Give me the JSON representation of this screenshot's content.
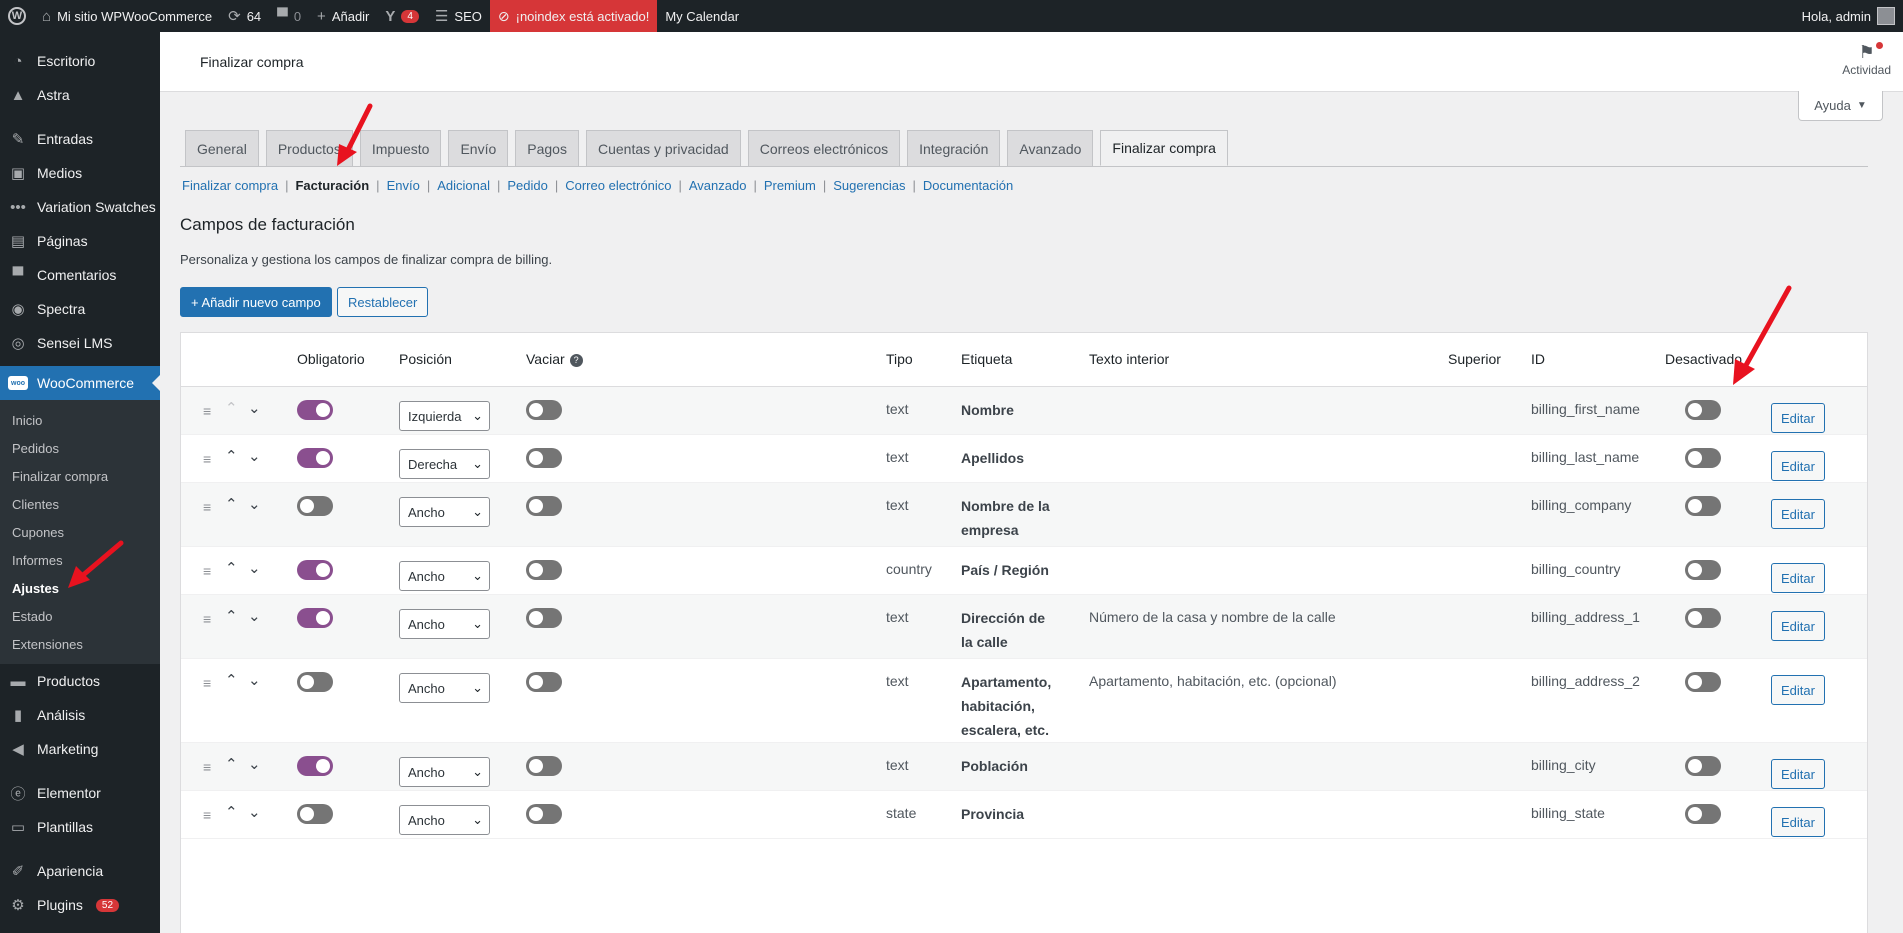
{
  "admin_bar": {
    "site_name": "Mi sitio WPWooCommerce",
    "updates_count": "64",
    "comments_count": "0",
    "add_label": "Añadir",
    "yoast_count": "4",
    "seo_label": "SEO",
    "noindex_label": "¡noindex está activado!",
    "calendar_label": "My Calendar",
    "greeting": "Hola, admin"
  },
  "sidebar": {
    "items_top": [
      {
        "label": "Escritorio",
        "icon": "dashboard-icon"
      },
      {
        "label": "Astra",
        "icon": "astra-icon"
      }
    ],
    "items_mid": [
      {
        "label": "Entradas",
        "icon": "pin-icon"
      },
      {
        "label": "Medios",
        "icon": "media-icon"
      },
      {
        "label": "Variation Swatches",
        "icon": "dots-icon"
      },
      {
        "label": "Páginas",
        "icon": "page-icon"
      },
      {
        "label": "Comentarios",
        "icon": "comment-icon"
      },
      {
        "label": "Spectra",
        "icon": "spectra-icon"
      },
      {
        "label": "Sensei LMS",
        "icon": "sensei-icon"
      }
    ],
    "woocommerce": {
      "label": "WooCommerce",
      "logo_text": "woo"
    },
    "woo_submenu": [
      "Inicio",
      "Pedidos",
      "Finalizar compra",
      "Clientes",
      "Cupones",
      "Informes",
      "Ajustes",
      "Estado",
      "Extensiones"
    ],
    "woo_current_sub": "Ajustes",
    "items_after": [
      {
        "label": "Productos",
        "icon": "products-icon"
      },
      {
        "label": "Análisis",
        "icon": "chart-icon"
      },
      {
        "label": "Marketing",
        "icon": "megaphone-icon"
      }
    ],
    "items_bottom": [
      {
        "label": "Elementor",
        "icon": "elementor-icon"
      },
      {
        "label": "Plantillas",
        "icon": "folder-icon"
      }
    ],
    "items_end": [
      {
        "label": "Apariencia",
        "icon": "brush-icon"
      },
      {
        "label": "Plugins",
        "icon": "plugin-icon",
        "badge": "52"
      }
    ]
  },
  "header": {
    "page_title": "Finalizar compra",
    "activity_label": "Actividad"
  },
  "help_label": "Ayuda",
  "tabs": [
    "General",
    "Productos",
    "Impuesto",
    "Envío",
    "Pagos",
    "Cuentas y privacidad",
    "Correos electrónicos",
    "Integración",
    "Avanzado",
    "Finalizar compra"
  ],
  "active_tab": "Finalizar compra",
  "subnav": [
    "Finalizar compra",
    "Facturación",
    "Envío",
    "Adicional",
    "Pedido",
    "Correo electrónico",
    "Avanzado",
    "Premium",
    "Sugerencias",
    "Documentación"
  ],
  "subnav_current": "Facturación",
  "section": {
    "title": "Campos de facturación",
    "description": "Personaliza y gestiona los campos de finalizar compra de billing.",
    "add_button": "+ Añadir nuevo campo",
    "reset_button": "Restablecer"
  },
  "table": {
    "headers": {
      "required": "Obligatorio",
      "position": "Posición",
      "clear": "Vaciar",
      "type": "Tipo",
      "label": "Etiqueta",
      "placeholder": "Texto interior",
      "priority": "Superior",
      "id": "ID",
      "disabled": "Desactivado"
    },
    "edit_label": "Editar",
    "rows": [
      {
        "required": true,
        "position": "Izquierda",
        "clear": false,
        "type": "text",
        "label": "Nombre",
        "placeholder": "",
        "id": "billing_first_name",
        "disabled": false,
        "first": true
      },
      {
        "required": true,
        "position": "Derecha",
        "clear": false,
        "type": "text",
        "label": "Apellidos",
        "placeholder": "",
        "id": "billing_last_name",
        "disabled": false
      },
      {
        "required": false,
        "position": "Ancho",
        "clear": false,
        "type": "text",
        "label": "Nombre de la empresa",
        "placeholder": "",
        "id": "billing_company",
        "disabled": false
      },
      {
        "required": true,
        "position": "Ancho",
        "clear": false,
        "type": "country",
        "label": "País / Región",
        "placeholder": "",
        "id": "billing_country",
        "disabled": false
      },
      {
        "required": true,
        "position": "Ancho",
        "clear": false,
        "type": "text",
        "label": "Dirección de la calle",
        "placeholder": "Número de la casa y nombre de la calle",
        "id": "billing_address_1",
        "disabled": false
      },
      {
        "required": false,
        "position": "Ancho",
        "clear": false,
        "type": "text",
        "label": "Apartamento, habitación, escalera, etc.",
        "placeholder": "Apartamento, habitación, etc. (opcional)",
        "id": "billing_address_2",
        "disabled": false
      },
      {
        "required": true,
        "position": "Ancho",
        "clear": false,
        "type": "text",
        "label": "Población",
        "placeholder": "",
        "id": "billing_city",
        "disabled": false
      },
      {
        "required": false,
        "position": "Ancho",
        "clear": false,
        "type": "state",
        "label": "Provincia",
        "placeholder": "",
        "id": "billing_state",
        "disabled": false
      }
    ]
  },
  "accent_colors": {
    "wp_blue": "#2271b1",
    "toggle_on": "#8a4f8f",
    "annotation_red": "#e8121f"
  }
}
